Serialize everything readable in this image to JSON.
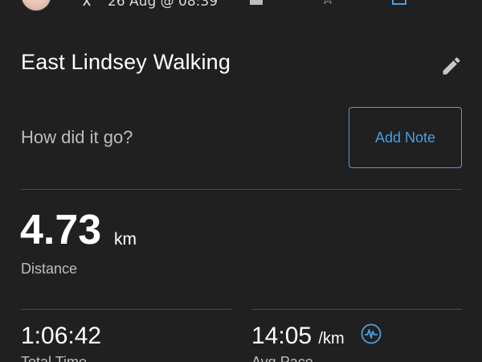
{
  "header": {
    "date": "26 Aug @ 08:39",
    "activity_type_icon": "walking-icon",
    "gear_icon": "shoe-icon",
    "favorite_icon": "star-icon",
    "save_icon": "save-icon"
  },
  "activity": {
    "title": "East Lindsey Walking",
    "edit_icon": "pencil-icon"
  },
  "note": {
    "prompt": "How did it go?",
    "add_label": "Add Note"
  },
  "stats": {
    "distance": {
      "value": "4.73",
      "unit": "km",
      "label": "Distance"
    },
    "total_time": {
      "value": "1:06:42",
      "label": "Total Time"
    },
    "avg_pace": {
      "value": "14:05",
      "unit": "/km",
      "label": "Avg Pace"
    }
  },
  "colors": {
    "background": "#202020",
    "accent": "#4a9fe0",
    "primary_text": "#ffffff",
    "secondary_text": "#bdbdbd",
    "divider": "#4a4a4a"
  }
}
